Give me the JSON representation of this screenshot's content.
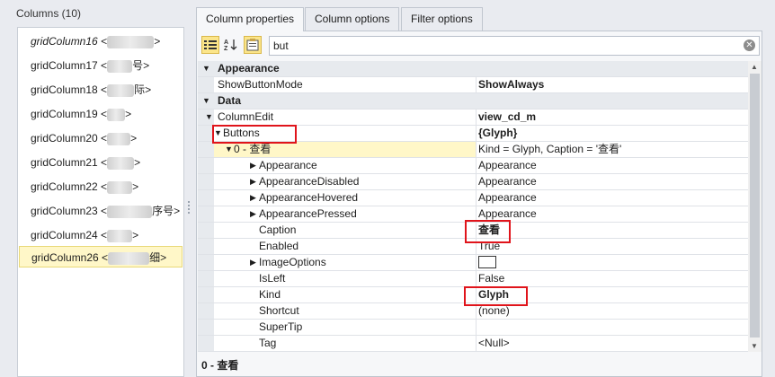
{
  "columns_panel": {
    "caption": "Columns (10)",
    "items": [
      {
        "label": "gridColumn16 <",
        "tail": ">",
        "italic": true,
        "selected": false
      },
      {
        "label": "gridColumn17 <",
        "tail": "号>",
        "italic": false,
        "selected": false
      },
      {
        "label": "gridColumn18 <",
        "tail": "际>",
        "italic": false,
        "selected": false
      },
      {
        "label": "gridColumn19 <",
        "tail": ">",
        "italic": false,
        "selected": false
      },
      {
        "label": "gridColumn20 <",
        "tail": ">",
        "italic": false,
        "selected": false
      },
      {
        "label": "gridColumn21 <",
        "tail": ">",
        "italic": false,
        "selected": false
      },
      {
        "label": "gridColumn22 <",
        "tail": ">",
        "italic": false,
        "selected": false
      },
      {
        "label": "gridColumn23 <",
        "tail": "序号>",
        "italic": false,
        "selected": false
      },
      {
        "label": "gridColumn24 <",
        "tail": ">",
        "italic": false,
        "selected": false
      },
      {
        "label": "gridColumn26 <",
        "tail": "细>",
        "italic": false,
        "selected": true
      }
    ]
  },
  "tabs": [
    {
      "label": "Column properties",
      "active": true
    },
    {
      "label": "Column options",
      "active": false
    },
    {
      "label": "Filter options",
      "active": false
    }
  ],
  "toolbar": {
    "categorized_icon": "categorized-icon",
    "alphabetical_icon": "sort-az-icon",
    "property_pages_icon": "property-pages-icon",
    "search_value": "but",
    "clear_glyph": "✕"
  },
  "grid": {
    "rows": [
      {
        "type": "cat",
        "name": "Appearance",
        "value": ""
      },
      {
        "type": "prop",
        "level": 0,
        "name": "ShowButtonMode",
        "value": "ShowAlways",
        "bold": true
      },
      {
        "type": "cat",
        "name": "Data",
        "value": ""
      },
      {
        "type": "prop",
        "level": 0,
        "expand": "down",
        "name": "ColumnEdit",
        "value": "view_cd_m",
        "bold": true
      },
      {
        "type": "prop",
        "level": 1,
        "expand": "down",
        "name": "Buttons",
        "value": "{Glyph}",
        "bold": true
      },
      {
        "type": "prop",
        "level": 2,
        "expand": "down",
        "name": "0 - 查看",
        "value": "Kind = Glyph, Caption = '查看'",
        "bold": false,
        "highlight": true
      },
      {
        "type": "prop",
        "level": 3,
        "expand": "right",
        "name": "Appearance",
        "value": "Appearance",
        "bold": false
      },
      {
        "type": "prop",
        "level": 3,
        "expand": "right",
        "name": "AppearanceDisabled",
        "value": "Appearance",
        "bold": false
      },
      {
        "type": "prop",
        "level": 3,
        "expand": "right",
        "name": "AppearanceHovered",
        "value": "Appearance",
        "bold": false
      },
      {
        "type": "prop",
        "level": 3,
        "expand": "right",
        "name": "AppearancePressed",
        "value": "Appearance",
        "bold": false
      },
      {
        "type": "prop",
        "level": 3,
        "name": "Caption",
        "value": "查看",
        "bold": true
      },
      {
        "type": "prop",
        "level": 3,
        "name": "Enabled",
        "value": "True",
        "bold": false
      },
      {
        "type": "prop",
        "level": 3,
        "expand": "right",
        "name": "ImageOptions",
        "value": "",
        "swatch": true,
        "bold": false
      },
      {
        "type": "prop",
        "level": 3,
        "name": "IsLeft",
        "value": "False",
        "bold": false
      },
      {
        "type": "prop",
        "level": 3,
        "name": "Kind",
        "value": "Glyph",
        "bold": true
      },
      {
        "type": "prop",
        "level": 3,
        "name": "Shortcut",
        "value": "(none)",
        "bold": false
      },
      {
        "type": "prop",
        "level": 3,
        "name": "SuperTip",
        "value": "",
        "bold": false
      },
      {
        "type": "prop",
        "level": 3,
        "name": "Tag",
        "value": "<Null>",
        "bold": false
      }
    ]
  },
  "status_text": "0 - 查看",
  "colors": {
    "highlight_box": "#e0141b",
    "selection": "#fff7c8",
    "category_bg": "#e7eaee"
  }
}
